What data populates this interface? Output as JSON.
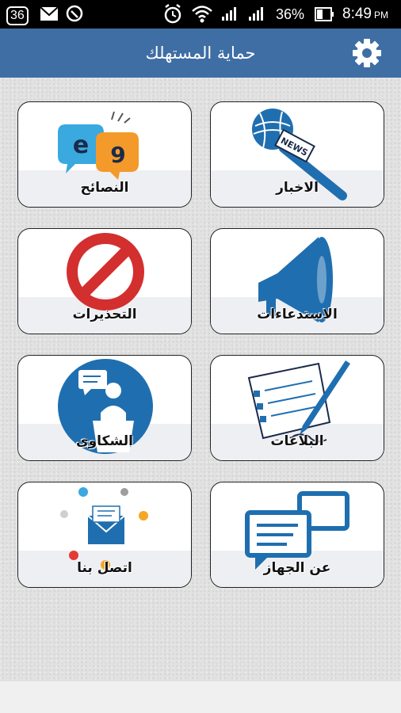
{
  "status_bar": {
    "notification_count": "36",
    "battery_percent": "36%",
    "time": "8:49",
    "time_suffix": "PM"
  },
  "app_bar": {
    "title": "حماية المستهلك"
  },
  "tiles": [
    {
      "label": "النصائح",
      "icon": "speech-bubbles-icon"
    },
    {
      "label": "الاخبار",
      "icon": "news-microphone-icon"
    },
    {
      "label": "التحذيرات",
      "icon": "prohibition-icon"
    },
    {
      "label": "الاستدعاءات",
      "icon": "megaphone-icon"
    },
    {
      "label": "الشكاوى",
      "icon": "speaker-podium-icon"
    },
    {
      "label": "البلاغات",
      "icon": "form-pen-icon"
    },
    {
      "label": "اتصل بنا",
      "icon": "contact-envelope-icon"
    },
    {
      "label": "عن الجهاز",
      "icon": "chat-bubbles-icon"
    }
  ],
  "colors": {
    "app_bar": "#3f6ea5",
    "icon_blue": "#1f6fb0",
    "warning_red": "#d32f2f"
  }
}
